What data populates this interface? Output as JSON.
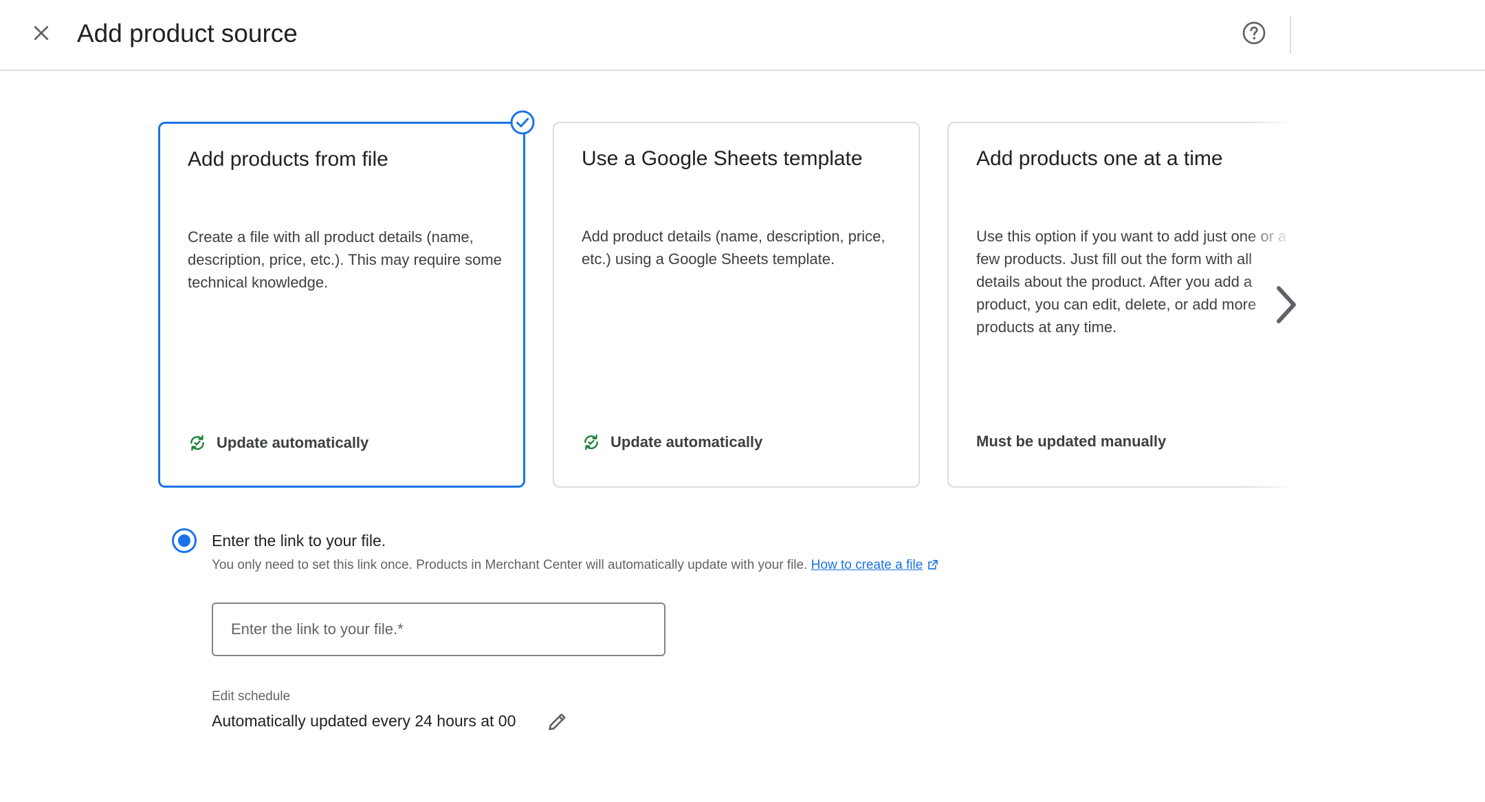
{
  "header": {
    "title": "Add product source",
    "close_icon": "close-icon",
    "help_icon": "help-icon"
  },
  "cards": [
    {
      "title": "Add products from file",
      "description": "Create a file with all product details (name, description, price, etc.). This may require some technical knowledge.",
      "footer": "Update automatically",
      "footer_icon": "sync-icon",
      "selected": true
    },
    {
      "title": "Use a Google Sheets template",
      "description": "Add product details (name, description, price, etc.) using a Google Sheets template.",
      "footer": "Update automatically",
      "footer_icon": "sync-icon",
      "selected": false
    },
    {
      "title": "Add products one at a time",
      "description": "Use this option if you want to add just one or a few products. Just fill out the form with all details about the product. After you add a product, you can edit, delete, or add more products at any time.",
      "footer": "Must be updated manually",
      "selected": false
    }
  ],
  "option": {
    "label": "Enter the link to your file.",
    "helper": "You only need to set this link once. Products in Merchant Center will automatically update with your file.",
    "link_text": "How to create a file",
    "input_placeholder": "Enter the link to your file.*",
    "input_value": ""
  },
  "schedule": {
    "label": "Edit schedule",
    "value": "Automatically updated every 24 hours at 00"
  },
  "colors": {
    "accent": "#1a73e8",
    "sync_green": "#188038",
    "border": "#dadce0",
    "text": "#202124",
    "secondary_text": "#5f6368"
  }
}
